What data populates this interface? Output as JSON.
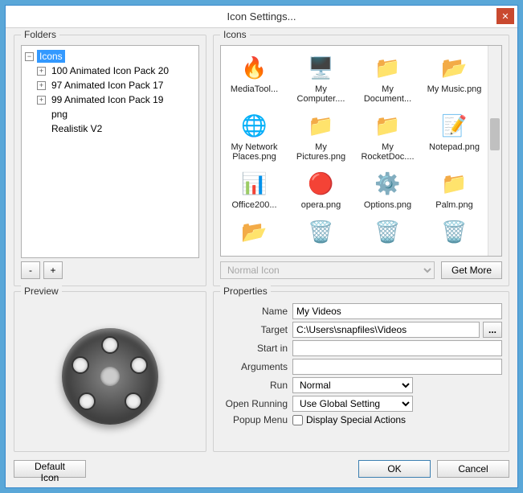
{
  "titlebar": {
    "title": "Icon Settings..."
  },
  "groups": {
    "folders": "Folders",
    "icons": "Icons",
    "preview": "Preview",
    "properties": "Properties"
  },
  "tree": {
    "root": "Icons",
    "children": [
      "100 Animated Icon Pack  20",
      "97 Animated Icon Pack  17",
      "99 Animated Icon Pack  19",
      "png",
      "Realistik V2"
    ]
  },
  "treeButtons": {
    "remove": "-",
    "add": "+"
  },
  "icons": [
    {
      "label": "MediaTool...",
      "glyph": "🔥",
      "name": "icon-mediatool"
    },
    {
      "label": "My Computer....",
      "glyph": "🖥️",
      "name": "icon-my-computer"
    },
    {
      "label": "My Document...",
      "glyph": "📁",
      "name": "icon-my-documents"
    },
    {
      "label": "My Music.png",
      "glyph": "📂",
      "name": "icon-my-music"
    },
    {
      "label": "My Network Places.png",
      "glyph": "🌐",
      "name": "icon-my-network"
    },
    {
      "label": "My Pictures.png",
      "glyph": "📁",
      "name": "icon-my-pictures"
    },
    {
      "label": "My RocketDoc....",
      "glyph": "📁",
      "name": "icon-rocketdock"
    },
    {
      "label": "Notepad.png",
      "glyph": "📝",
      "name": "icon-notepad"
    },
    {
      "label": "Office200...",
      "glyph": "📊",
      "name": "icon-office"
    },
    {
      "label": "opera.png",
      "glyph": "🔴",
      "name": "icon-opera"
    },
    {
      "label": "Options.png",
      "glyph": "⚙️",
      "name": "icon-options"
    },
    {
      "label": "Palm.png",
      "glyph": "📁",
      "name": "icon-palm"
    },
    {
      "label": "",
      "glyph": "📂",
      "name": "icon-row5-a"
    },
    {
      "label": "",
      "glyph": "🗑️",
      "name": "icon-row5-b"
    },
    {
      "label": "",
      "glyph": "🗑️",
      "name": "icon-row5-c"
    },
    {
      "label": "",
      "glyph": "🗑️",
      "name": "icon-row5-d"
    }
  ],
  "iconSelect": "Normal Icon",
  "getMore": "Get More",
  "properties": {
    "name_label": "Name",
    "name_value": "My Videos",
    "target_label": "Target",
    "target_value": "C:\\Users\\snapfiles\\Videos",
    "startin_label": "Start in",
    "startin_value": "",
    "args_label": "Arguments",
    "args_value": "",
    "run_label": "Run",
    "run_value": "Normal",
    "open_label": "Open Running",
    "open_value": "Use Global Setting",
    "popup_label": "Popup Menu",
    "popup_check": "Display Special Actions"
  },
  "buttons": {
    "default": "Default Icon",
    "ok": "OK",
    "cancel": "Cancel",
    "browse": "..."
  }
}
